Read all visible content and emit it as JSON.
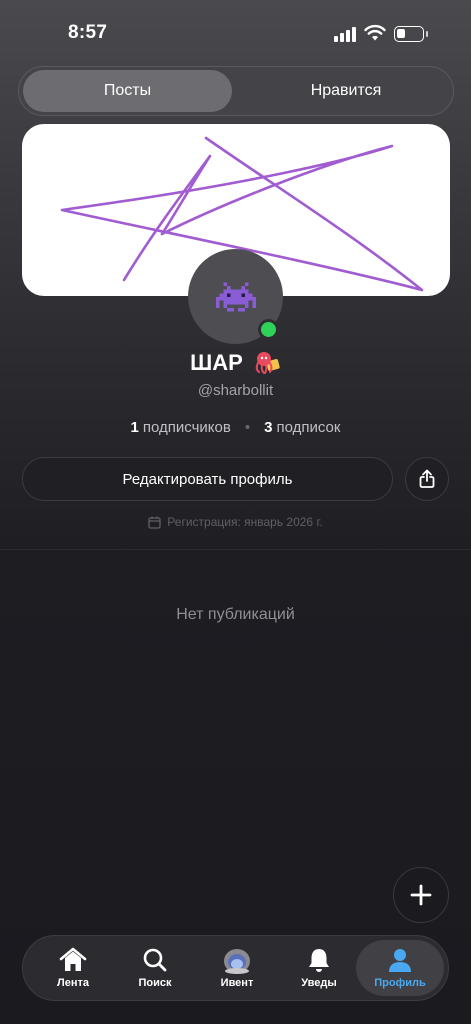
{
  "status_bar": {
    "time": "8:57"
  },
  "tabs": [
    {
      "label": "Посты",
      "active": true
    },
    {
      "label": "Нравится",
      "active": false
    }
  ],
  "profile": {
    "display_name": "ШАР",
    "username": "@sharbollit",
    "online": true,
    "avatar_icon": "alien-monster-icon",
    "name_icon": "octopus-sticker-icon"
  },
  "stats": {
    "followers_count": "1",
    "followers_label": "подписчиков",
    "following_count": "3",
    "following_label": "подписок"
  },
  "actions": {
    "edit_profile": "Редактировать профиль",
    "share_icon": "share-icon"
  },
  "registration": {
    "text": "Регистрация: январь 2026 г.",
    "icon": "calendar-icon"
  },
  "empty_state": "Нет публикаций",
  "fab_icon": "plus-icon",
  "bottom_nav": [
    {
      "label": "Лента",
      "icon": "home-icon",
      "active": false
    },
    {
      "label": "Поиск",
      "icon": "search-icon",
      "active": false
    },
    {
      "label": "Ивент",
      "icon": "event-icon",
      "active": false
    },
    {
      "label": "Уведы",
      "icon": "bell-icon",
      "active": false
    },
    {
      "label": "Профиль",
      "icon": "profile-icon",
      "active": true
    }
  ],
  "colors": {
    "accent": "#4aa8f0",
    "online": "#2fd158",
    "banner_stroke": "#a05cd0"
  }
}
